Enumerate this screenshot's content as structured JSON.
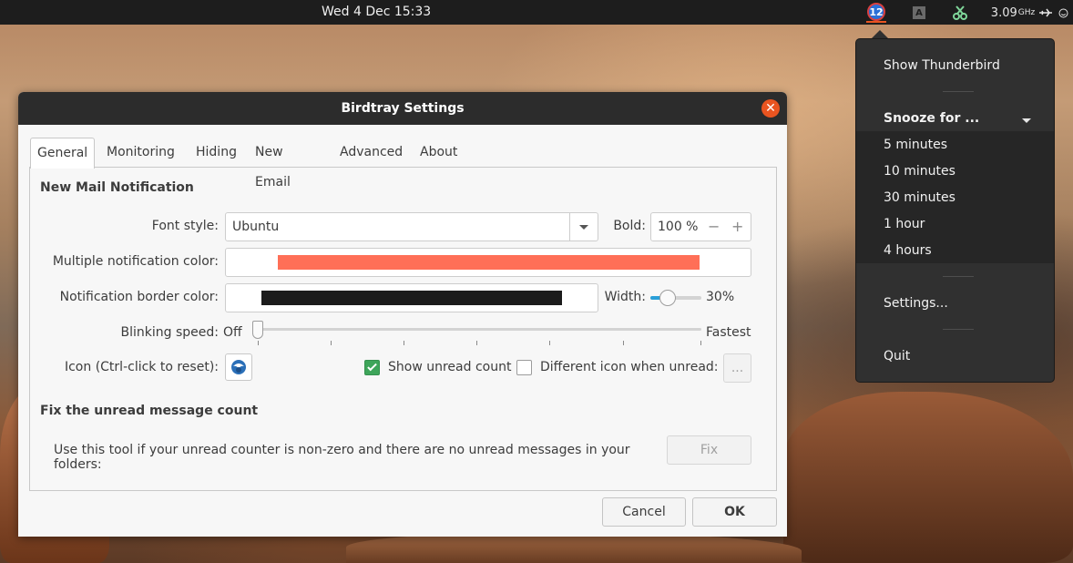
{
  "topbar": {
    "clock": "Wed 4 Dec  15:33",
    "tray": {
      "birdtray_badge": "12",
      "cpu_freq": "3.09",
      "cpu_unit": "GHz",
      "icons": [
        "birdtray-icon",
        "keyboard-layout-icon",
        "clipboard-scissors-icon",
        "cpu-freq-icon",
        "network-icon",
        "status-icon"
      ]
    }
  },
  "tray_menu": {
    "show": "Show Thunderbird",
    "snooze": "Snooze for ...",
    "snooze_options": [
      "5 minutes",
      "10 minutes",
      "30 minutes",
      "1 hour",
      "4 hours"
    ],
    "settings": "Settings...",
    "quit": "Quit"
  },
  "dialog": {
    "title": "Birdtray Settings",
    "tabs": [
      "General",
      "Monitoring",
      "Hiding",
      "New Email",
      "Advanced",
      "About"
    ],
    "active_tab": "General",
    "new_mail": {
      "heading": "New Mail Notification",
      "font_style_label": "Font style:",
      "font_style_value": "Ubuntu",
      "bold_label": "Bold:",
      "bold_value": "100 %",
      "bold_minus": "−",
      "bold_plus": "+",
      "multi_color_label": "Multiple notification color:",
      "multi_color": "#ff6f57",
      "border_color_label": "Notification border color:",
      "border_color": "#1c1c1c",
      "width_label": "Width:",
      "width_value": "30%",
      "width_level": 0.3,
      "blink_label": "Blinking speed:",
      "blink_off": "Off",
      "blink_fastest": "Fastest",
      "blink_level": 0,
      "icon_label": "Icon (Ctrl-click to reset):",
      "show_unread_label": "Show unread count",
      "show_unread_checked": true,
      "diff_icon_label": "Different icon when unread:",
      "diff_icon_checked": false,
      "diff_icon_button": "..."
    },
    "fix_count": {
      "heading": "Fix the unread message count",
      "description": "Use this tool if your unread counter is non-zero and there are no unread messages in your folders:",
      "button": "Fix"
    },
    "buttons": {
      "cancel": "Cancel",
      "ok": "OK"
    }
  },
  "colors": {
    "accent": "#e95420",
    "checkbox_on": "#3ea55a",
    "slider_fill": "#2a9fd8"
  }
}
